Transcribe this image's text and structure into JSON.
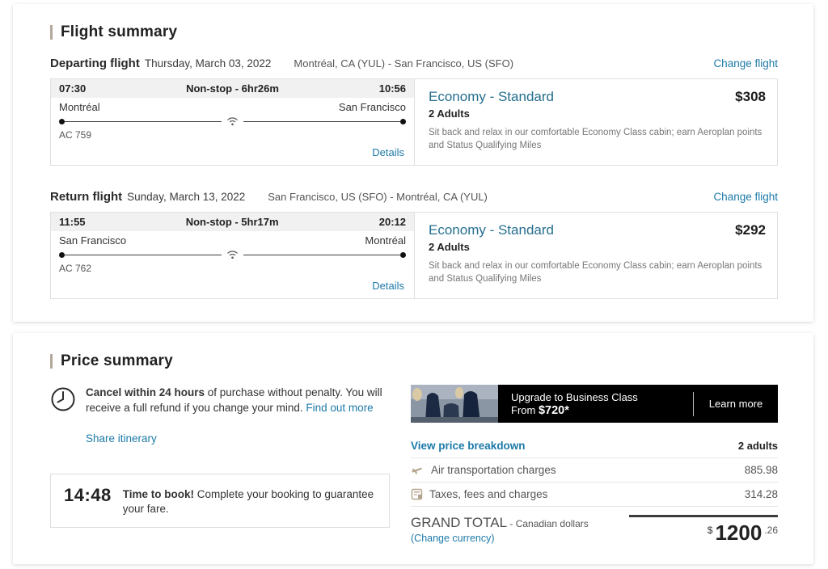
{
  "colors": {
    "link_blue": "#1d7aa8",
    "fare_teal": "#266e8e",
    "accent_tan": "#b3a89c",
    "banner_black": "#000000",
    "icon_tan": "#b5a48d"
  },
  "flight_summary": {
    "title": "Flight summary",
    "departing": {
      "label": "Departing flight",
      "date": "Thursday, March 03, 2022",
      "route": "Montréal, CA (YUL) - San Francisco, US (SFO)",
      "change_link": "Change flight",
      "dep_time": "07:30",
      "stop_info": "Non-stop - 6hr26m",
      "arr_time": "10:56",
      "origin": "Montréal",
      "destination": "San Francisco",
      "flight_no": "AC 759",
      "details_link": "Details",
      "fare_class": "Economy - Standard",
      "price": "$308",
      "passengers": "2 Adults",
      "description": "Sit back and relax in our comfortable Economy Class cabin; earn Aeroplan points and Status Qualifying Miles"
    },
    "return": {
      "label": "Return flight",
      "date": "Sunday, March 13, 2022",
      "route": "San Francisco, US (SFO) - Montréal, CA (YUL)",
      "change_link": "Change flight",
      "dep_time": "11:55",
      "stop_info": "Non-stop - 5hr17m",
      "arr_time": "20:12",
      "origin": "San Francisco",
      "destination": "Montréal",
      "flight_no": "AC 762",
      "details_link": "Details",
      "fare_class": "Economy - Standard",
      "price": "$292",
      "passengers": "2 Adults",
      "description": "Sit back and relax in our comfortable Economy Class cabin; earn Aeroplan points and Status Qualifying Miles"
    }
  },
  "price_summary": {
    "title": "Price summary",
    "cancel_bold": "Cancel within 24 hours",
    "cancel_rest": " of purchase without penalty. You will receive a full refund if you change your mind. ",
    "find_out_more": "Find out more",
    "share_itinerary": "Share itinerary",
    "timer": "14:48",
    "book_bold": "Time to book!",
    "book_rest": " Complete your booking to guarantee your fare.",
    "banner": {
      "line1": "Upgrade to Business Class",
      "line2_prefix": "From ",
      "line2_price": "$720*",
      "cta": "Learn more"
    },
    "breakdown": {
      "view_link": "View price breakdown",
      "adults": "2 adults",
      "rows": [
        {
          "icon": "airplane-icon",
          "label": "Air transportation charges",
          "value": "885.98"
        },
        {
          "icon": "taxes-icon",
          "label": "Taxes, fees and charges",
          "value": "314.28"
        }
      ],
      "grand_total_label": "GRAND TOTAL",
      "grand_total_sub": " - Canadian dollars",
      "change_currency": "(Change currency)",
      "currency_symbol": "$",
      "total_main": "1200",
      "total_cents": ".26"
    }
  }
}
